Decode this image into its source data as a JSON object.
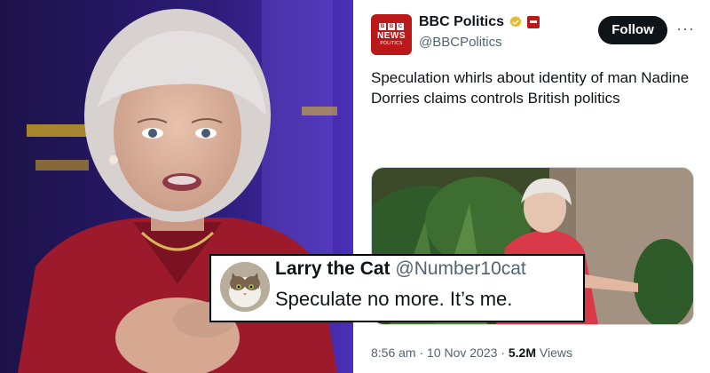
{
  "tweet": {
    "avatar_logo": {
      "blocks": [
        "B",
        "B",
        "C"
      ],
      "word": "NEWS",
      "sub": "POLITICS"
    },
    "account_name": "BBC Politics",
    "handle": "@BBCPolitics",
    "follow_label": "Follow",
    "more_label": "···",
    "text": "Speculation whirls about identity of man Nadine Dorries claims controls British politics",
    "timestamp": "8:56 am · 10 Nov 2023 · ",
    "views_count": "5.2M",
    "views_label": " Views"
  },
  "reply": {
    "name": "Larry the Cat",
    "handle": "@Number10cat",
    "text": "Speculate no more. It’s me."
  },
  "colors": {
    "bbc_red": "#bb1919",
    "verified_gold": "#e8b829",
    "text_primary": "#0f1419",
    "text_secondary": "#536471",
    "studio_purple": "#2a1a6e",
    "jacket_red": "#a01a2e"
  },
  "icons": [
    "verified-badge-icon",
    "affiliate-badge-icon",
    "more-options-icon"
  ]
}
